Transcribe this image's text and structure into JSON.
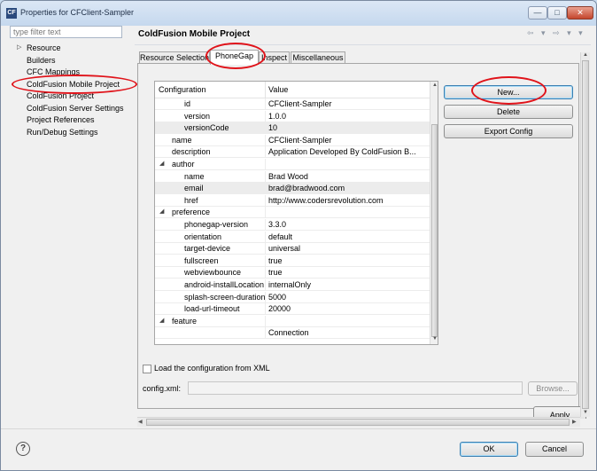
{
  "window": {
    "title": "Properties for CFClient-Sampler",
    "app_icon": "CF",
    "minimize_glyph": "—",
    "maximize_glyph": "□",
    "close_glyph": "✕"
  },
  "filter": {
    "placeholder": "type filter text"
  },
  "tree": [
    {
      "label": "Resource",
      "expandable": true
    },
    {
      "label": "Builders"
    },
    {
      "label": "CFC Mappings"
    },
    {
      "label": "ColdFusion Mobile Project",
      "selected": true
    },
    {
      "label": "ColdFusion Project"
    },
    {
      "label": "ColdFusion Server Settings"
    },
    {
      "label": "Project References"
    },
    {
      "label": "Run/Debug Settings"
    }
  ],
  "page_title": "ColdFusion Mobile Project",
  "nav": {
    "back_icon": "back-arrow-icon",
    "forward_icon": "forward-arrow-icon",
    "menu_icon": "view-menu-icon",
    "glyphs": "⇦ ▾ ⇨ ▾ ▾"
  },
  "tabs": [
    {
      "label": "Resource Selection"
    },
    {
      "label": "PhoneGap",
      "active": true
    },
    {
      "label": "Inspect"
    },
    {
      "label": "Miscellaneous"
    }
  ],
  "table": {
    "headers": {
      "configuration": "Configuration",
      "value": "Value"
    },
    "rows": [
      {
        "key": "id",
        "value": "CFClient-Sampler",
        "indent": 2
      },
      {
        "key": "version",
        "value": "1.0.0",
        "indent": 2
      },
      {
        "key": "versionCode",
        "value": "10",
        "indent": 2,
        "selected": true
      },
      {
        "key": "name",
        "value": "CFClient-Sampler",
        "indent": 1
      },
      {
        "key": "description",
        "value": "Application Developed By ColdFusion B...",
        "indent": 1
      },
      {
        "key": "author",
        "value": "",
        "indent": 0,
        "expanded": true
      },
      {
        "key": "name",
        "value": "Brad Wood",
        "indent": 2
      },
      {
        "key": "email",
        "value": "brad@bradwood.com",
        "indent": 2,
        "selected": true
      },
      {
        "key": "href",
        "value": "http://www.codersrevolution.com",
        "indent": 2
      },
      {
        "key": "preference",
        "value": "",
        "indent": 0,
        "expanded": true
      },
      {
        "key": "phonegap-version",
        "value": "3.3.0",
        "indent": 2
      },
      {
        "key": "orientation",
        "value": "default",
        "indent": 2
      },
      {
        "key": "target-device",
        "value": "universal",
        "indent": 2
      },
      {
        "key": "fullscreen",
        "value": "true",
        "indent": 2
      },
      {
        "key": "webviewbounce",
        "value": "true",
        "indent": 2
      },
      {
        "key": "android-installLocation",
        "value": "internalOnly",
        "indent": 2
      },
      {
        "key": "splash-screen-duration",
        "value": "5000",
        "indent": 2
      },
      {
        "key": "load-url-timeout",
        "value": "20000",
        "indent": 2
      },
      {
        "key": "feature",
        "value": "",
        "indent": 0,
        "expanded": true
      },
      {
        "key": "",
        "value": "Connection",
        "indent": 2
      }
    ]
  },
  "buttons": {
    "new": "New...",
    "delete": "Delete",
    "export": "Export Config",
    "browse": "Browse...",
    "apply": "Apply",
    "ok": "OK",
    "cancel": "Cancel",
    "help": "?"
  },
  "load_config": {
    "label": "Load the configuration from XML",
    "checked": false
  },
  "config_xml": {
    "label": "config.xml:",
    "value": ""
  },
  "colors": {
    "annotation": "#e0131a",
    "default_button_border": "#3c7fb1",
    "title_text": "#1c2c44"
  }
}
